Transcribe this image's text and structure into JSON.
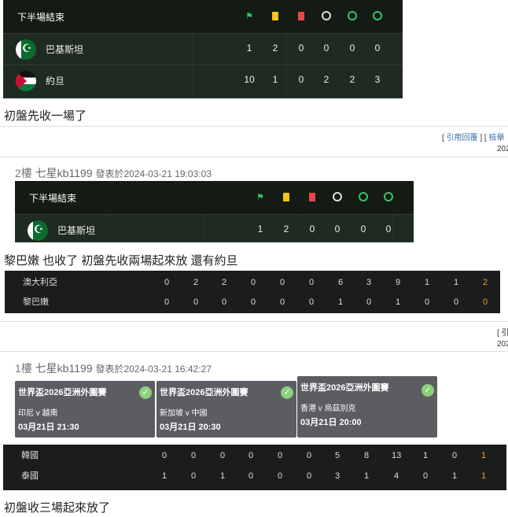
{
  "panel1": {
    "header": "下半場結束",
    "teams": [
      {
        "name": "巴基斯坦",
        "stats": [
          "1",
          "2",
          "0",
          "0",
          "0",
          "0"
        ]
      },
      {
        "name": "約旦",
        "stats": [
          "10",
          "1",
          "0",
          "2",
          "2",
          "3"
        ]
      }
    ]
  },
  "post1_text": "初盤先收一場了",
  "links_top": {
    "quote": "引用回覆",
    "report": "檢舉"
  },
  "truncated_top": "202",
  "floor2": {
    "floor": "2樓",
    "user": "七星kb1199",
    "posted": "發表於2024-03-21 19:03:03"
  },
  "panel2": {
    "header": "下半場結束",
    "team": "巴基斯坦",
    "stats": [
      "1",
      "2",
      "0",
      "0",
      "0",
      "0"
    ]
  },
  "post2_text": "黎巴嫩 也收了 初盤先收兩場起來放 還有約旦",
  "bar1": {
    "rows": [
      {
        "team": "澳大利亞",
        "values": [
          "0",
          "2",
          "2",
          "0",
          "0",
          "0",
          "6",
          "3",
          "9",
          "1",
          "1",
          "2"
        ]
      },
      {
        "team": "黎巴嫩",
        "values": [
          "0",
          "0",
          "0",
          "0",
          "0",
          "0",
          "1",
          "0",
          "1",
          "0",
          "0",
          "0"
        ]
      }
    ]
  },
  "links_mid": {
    "bracket": "[ 引"
  },
  "truncated_mid": "202",
  "floor1": {
    "floor": "1樓",
    "user": "七星kb1199",
    "posted": "發表於2024-03-21 16:42:27"
  },
  "cards": [
    {
      "title": "世界盃2026亞洲外圍賽",
      "match": "印尼 v 越南",
      "date": "03月21日 21:30"
    },
    {
      "title": "世界盃2026亞洲外圍賽",
      "match": "新加坡 v 中國",
      "date": "03月21日 20:30"
    },
    {
      "title": "世界盃2026亞洲外圍賽",
      "match": "香港 v 烏茲別克",
      "date": "03月21日 20:00"
    }
  ],
  "bar2": {
    "rows": [
      {
        "team": "韓國",
        "values": [
          "0",
          "0",
          "0",
          "0",
          "0",
          "0",
          "5",
          "8",
          "13",
          "1",
          "0",
          "1"
        ]
      },
      {
        "team": "泰國",
        "values": [
          "1",
          "0",
          "1",
          "0",
          "0",
          "0",
          "3",
          "1",
          "4",
          "0",
          "1",
          "1"
        ]
      }
    ]
  },
  "post3_text": "初盤收三場起來放了"
}
